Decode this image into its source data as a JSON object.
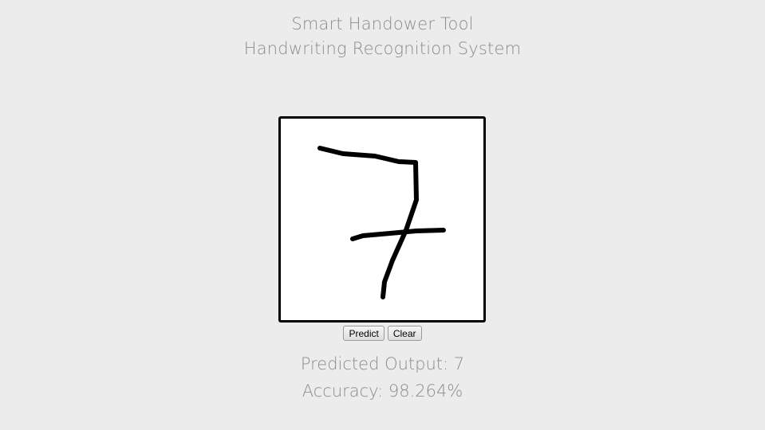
{
  "header": {
    "title": "Smart Handower Tool",
    "subtitle": "Handwriting Recognition System"
  },
  "canvas": {
    "drawn_digit": "7",
    "ink_color": "#000000",
    "background_color": "#ffffff"
  },
  "controls": {
    "predict_label": "Predict",
    "clear_label": "Clear"
  },
  "results": {
    "predicted_label": "Predicted Output: 7",
    "accuracy_label": "Accuracy: 98.264%"
  }
}
